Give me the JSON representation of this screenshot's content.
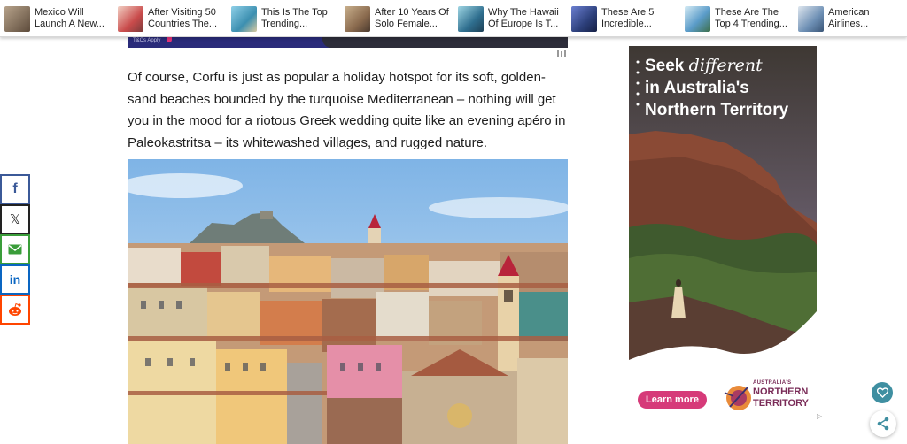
{
  "topbar": {
    "items": [
      {
        "title": "Mexico Will Launch A New...",
        "thumb_color": "#7a6b5a"
      },
      {
        "title": "After Visiting 50 Countries The...",
        "thumb_color": "#c94b4b"
      },
      {
        "title": "This Is The Top Trending...",
        "thumb_color": "#3c8fb0"
      },
      {
        "title": "After 10 Years Of Solo Female...",
        "thumb_color": "#8a6a4e"
      },
      {
        "title": "Why The Hawaii Of Europe Is T...",
        "thumb_color": "#2f6f8f"
      },
      {
        "title": "These Are 5 Incredible...",
        "thumb_color": "#2c3f7a"
      },
      {
        "title": "These Are The Top 4 Trending...",
        "thumb_color": "#5b9cc9"
      },
      {
        "title": "American Airlines...",
        "thumb_color": "#6d8fb4"
      }
    ]
  },
  "adstrip": {
    "label": "T&Cs Apply"
  },
  "article": {
    "paragraph": "Of course, Corfu is just as popular a holiday hotspot for its soft, golden-sand beaches bounded by the turquoise Mediterranean – nothing will get you in the mood for a riotous Greek wedding quite like an evening apéro in Paleokastritsa – its whitewashed villages, and rugged nature."
  },
  "share": {
    "facebook": "f",
    "x": "𝕏",
    "linkedin": "in"
  },
  "ad": {
    "headline_1a": "Seek ",
    "headline_1b": "different",
    "headline_2": "in Australia's",
    "headline_3": "Northern Territory",
    "cta": "Learn more",
    "brand_small": "AUSTRALIA'S",
    "brand_1": "NORTHERN",
    "brand_2": "TERRITORY",
    "accent": "#d63a79"
  },
  "colors": {
    "facebook": "#3b5998",
    "email": "#3a9d3a",
    "linkedin": "#0a66c2",
    "reddit": "#ff4500",
    "fab": "#3f8fa1"
  }
}
